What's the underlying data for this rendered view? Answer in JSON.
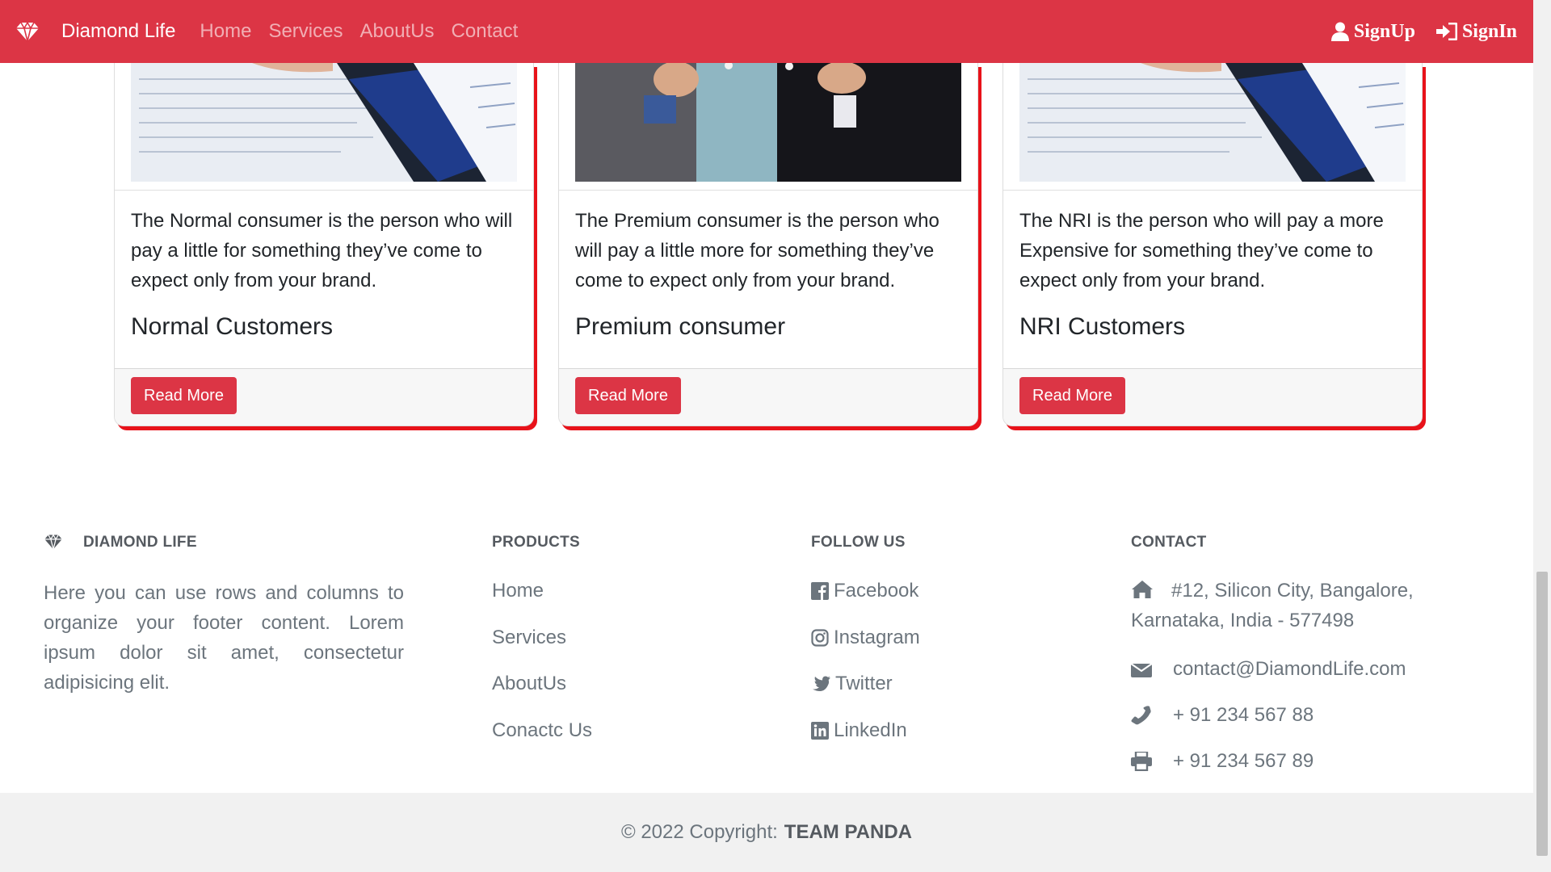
{
  "navbar": {
    "brand": "Diamond Life",
    "links": [
      "Home",
      "Services",
      "AboutUs",
      "Contact"
    ],
    "signup": "SignUp",
    "signin": "SignIn"
  },
  "cards": [
    {
      "text": "The Normal consumer is the person who will pay a little for something they’ve come to expect only from your brand.",
      "title": "Normal Customers",
      "button": "Read More"
    },
    {
      "text": "The Premium consumer is the person who will pay a little more for something they’ve come to expect only from your brand.",
      "title": "Premium consumer",
      "button": "Read More"
    },
    {
      "text": "The NRI is the person who will pay a more Expensive for something they’ve come to expect only from your brand.",
      "title": "NRI Customers",
      "button": "Read More"
    }
  ],
  "footer": {
    "brand_heading": "DIAMOND LIFE",
    "about": "Here you can use rows and columns to organize your footer content. Lorem ipsum dolor sit amet, consectetur adipisicing elit.",
    "products_heading": "PRODUCTS",
    "products": [
      "Home",
      "Services",
      "AboutUs",
      "Conactc Us"
    ],
    "follow_heading": "FOLLOW US",
    "follow": [
      {
        "label": "Facebook",
        "icon": "facebook-icon"
      },
      {
        "label": "Instagram",
        "icon": "instagram-icon"
      },
      {
        "label": "Twitter",
        "icon": "twitter-icon"
      },
      {
        "label": "LinkedIn",
        "icon": "linkedin-icon"
      }
    ],
    "contact_heading": "CONTACT",
    "contact": {
      "address": "#12, Silicon City, Bangalore, Karnataka, India - 577498",
      "email": "contact@DiamondLife.com",
      "phone": "+ 91 234 567 88",
      "fax": "+ 91 234 567 89"
    }
  },
  "copyright": {
    "text": "© 2022 Copyright:",
    "owner": "TEAM PANDA"
  },
  "colors": {
    "accent": "#dc3545",
    "card_shadow": "#e8121a"
  }
}
